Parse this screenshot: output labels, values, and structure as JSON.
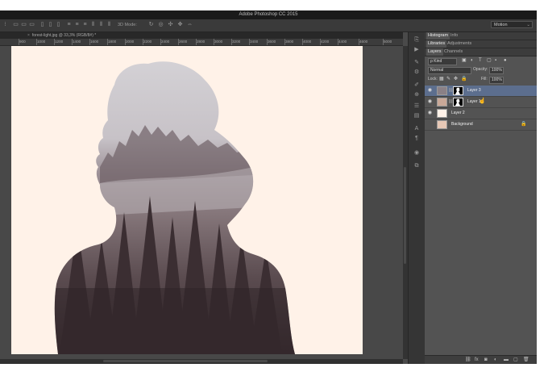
{
  "app": {
    "title": "Adobe Photoshop CC 2015"
  },
  "options_bar": {
    "mode_label": "3D Mode:",
    "workspace": "Motion"
  },
  "document": {
    "tab_label": "forest-light.jpg @ 33,3% (RGB/8#) *",
    "close_glyph": "×"
  },
  "ruler": {
    "ticks": [
      "900",
      "1000",
      "1200",
      "1400",
      "1600",
      "1800",
      "2000",
      "2200",
      "2400",
      "2600",
      "2800",
      "3000",
      "3200",
      "3400",
      "3600",
      "3800",
      "4000",
      "4200",
      "4400",
      "4600",
      "5000"
    ]
  },
  "panels": {
    "row1": [
      "Histogram",
      "Info"
    ],
    "row2": [
      "Libraries",
      "Adjustments"
    ],
    "row3": [
      "Layers",
      "Channels"
    ]
  },
  "layers_panel": {
    "filter_kind": "ρ Kind",
    "blend_mode": "Normal",
    "opacity_label": "Opacity:",
    "opacity_value": "100%",
    "lock_label": "Lock:",
    "fill_label": "Fill:",
    "fill_value": "100%",
    "layers": [
      {
        "name": "Layer 3",
        "selected": true
      },
      {
        "name": "Layer 1",
        "selected": false
      },
      {
        "name": "Layer 2",
        "selected": false
      },
      {
        "name": "Background",
        "selected": false,
        "locked": true
      }
    ]
  },
  "colors": {
    "accent_selection": "#5c6e8e",
    "canvas_bg": "#fff2e8",
    "ui_dark": "#1a1a1a"
  }
}
